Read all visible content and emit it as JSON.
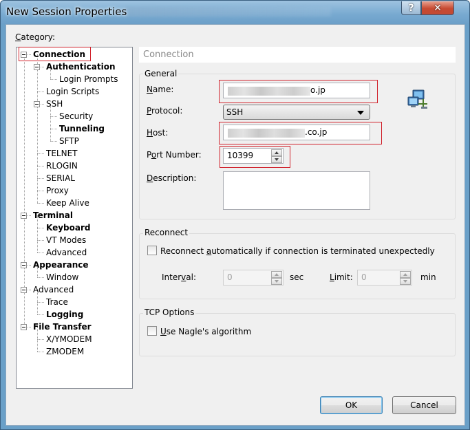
{
  "window": {
    "title": "New Session Properties",
    "help_glyph": "?",
    "close_glyph": "✕"
  },
  "category": {
    "label_prefix": "",
    "label_u": "C",
    "label_rest": "ategory:",
    "tree": [
      {
        "label": "Connection",
        "bold": true
      },
      {
        "label": "Authentication",
        "bold": true
      },
      {
        "label": "Login Prompts",
        "bold": false
      },
      {
        "label": "Login Scripts",
        "bold": false
      },
      {
        "label": "SSH",
        "bold": false
      },
      {
        "label": "Security",
        "bold": false
      },
      {
        "label": "Tunneling",
        "bold": true
      },
      {
        "label": "SFTP",
        "bold": false
      },
      {
        "label": "TELNET",
        "bold": false
      },
      {
        "label": "RLOGIN",
        "bold": false
      },
      {
        "label": "SERIAL",
        "bold": false
      },
      {
        "label": "Proxy",
        "bold": false
      },
      {
        "label": "Keep Alive",
        "bold": false
      },
      {
        "label": "Terminal",
        "bold": true
      },
      {
        "label": "Keyboard",
        "bold": true
      },
      {
        "label": "VT Modes",
        "bold": false
      },
      {
        "label": "Advanced",
        "bold": false
      },
      {
        "label": "Appearance",
        "bold": true
      },
      {
        "label": "Window",
        "bold": false
      },
      {
        "label": "Advanced",
        "bold": false
      },
      {
        "label": "Trace",
        "bold": false
      },
      {
        "label": "Logging",
        "bold": true
      },
      {
        "label": "File Transfer",
        "bold": true
      },
      {
        "label": "X/YMODEM",
        "bold": false
      },
      {
        "label": "ZMODEM",
        "bold": false
      }
    ]
  },
  "panel": {
    "header": "Connection",
    "general": {
      "title": "General",
      "name_label_u": "N",
      "name_label_rest": "ame:",
      "name_value_suffix": "o.jp",
      "protocol_label_u": "P",
      "protocol_label_rest": "rotocol:",
      "protocol_value": "SSH",
      "host_label_u": "H",
      "host_label_rest": "ost:",
      "host_value_suffix": ".co.jp",
      "port_label_pre": "P",
      "port_label_u": "o",
      "port_label_rest": "rt Number:",
      "port_value": "10399",
      "desc_label_u": "D",
      "desc_label_rest": "escription:",
      "desc_value": ""
    },
    "reconnect": {
      "title": "Reconnect",
      "checkbox_pre": "Reconnect ",
      "checkbox_u": "a",
      "checkbox_rest": "utomatically if connection is terminated unexpectedly",
      "interval_pre": "Inter",
      "interval_u": "v",
      "interval_rest": "al:",
      "interval_value": "0",
      "interval_unit": "sec",
      "limit_u": "L",
      "limit_rest": "imit:",
      "limit_value": "0",
      "limit_unit": "min"
    },
    "tcp": {
      "title": "TCP Options",
      "nagle_u": "U",
      "nagle_rest": "se Nagle's algorithm"
    }
  },
  "buttons": {
    "ok": "OK",
    "cancel": "Cancel"
  }
}
